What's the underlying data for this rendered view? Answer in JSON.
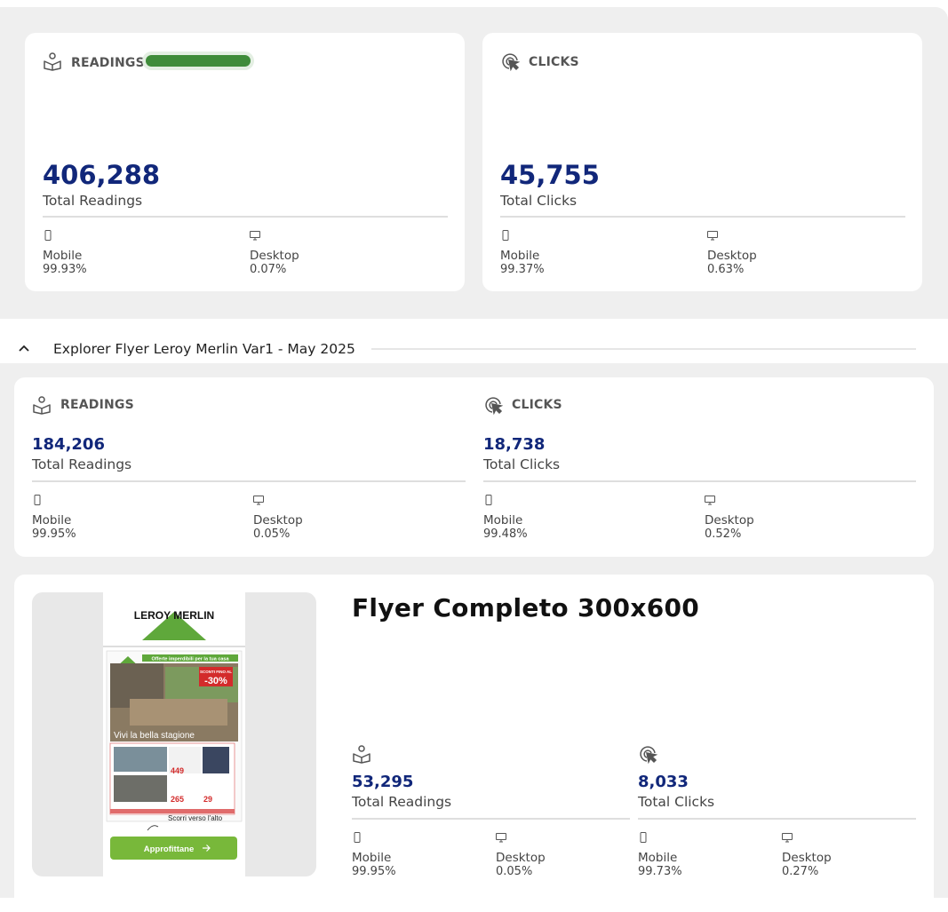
{
  "top_readings": {
    "label": "READINGS",
    "value": "406,288",
    "sub": "Total Readings",
    "progress": 1.0,
    "mobile_label": "Mobile",
    "mobile_pct": "99.93%",
    "desktop_label": "Desktop",
    "desktop_pct": "0.07%"
  },
  "top_clicks": {
    "label": "CLICKS",
    "value": "45,755",
    "sub": "Total Clicks",
    "mobile_label": "Mobile",
    "mobile_pct": "99.37%",
    "desktop_label": "Desktop",
    "desktop_pct": "0.63%"
  },
  "section": {
    "title": "Explorer Flyer Leroy Merlin Var1 - May 2025"
  },
  "sec_readings": {
    "label": "READINGS",
    "value": "184,206",
    "sub": "Total Readings",
    "mobile_label": "Mobile",
    "mobile_pct": "99.95%",
    "desktop_label": "Desktop",
    "desktop_pct": "0.05%"
  },
  "sec_clicks": {
    "label": "CLICKS",
    "value": "18,738",
    "sub": "Total Clicks",
    "mobile_label": "Mobile",
    "mobile_pct": "99.48%",
    "desktop_label": "Desktop",
    "desktop_pct": "0.52%"
  },
  "creative": {
    "title": "Flyer Completo 300x600",
    "flyer": {
      "brand": "LEROY MERLIN",
      "banner": "Offerte imperdibili per la tua casa",
      "discount_top": "SCONTI FINO AL",
      "discount": "-30%",
      "tagline": "Vivi la bella stagione",
      "price1": "449",
      "price2": "265",
      "price3": "29",
      "scroll_hint": "Scorri verso l'alto",
      "cta": "Approfittane"
    },
    "readings": {
      "value": "53,295",
      "sub": "Total Readings",
      "mobile_label": "Mobile",
      "mobile_pct": "99.95%",
      "desktop_label": "Desktop",
      "desktop_pct": "0.05%"
    },
    "clicks": {
      "value": "8,033",
      "sub": "Total Clicks",
      "mobile_label": "Mobile",
      "mobile_pct": "99.73%",
      "desktop_label": "Desktop",
      "desktop_pct": "0.27%"
    }
  },
  "colors": {
    "accent": "#11277a",
    "progress": "#3f8c3a",
    "cta": "#78b83a",
    "brand_green": "#5fa83b"
  },
  "icons": [
    "book-reader-icon",
    "cursor-click-icon",
    "mobile-icon",
    "desktop-icon",
    "chevron-up-icon",
    "arrow-right-icon",
    "hand-scroll-icon"
  ]
}
